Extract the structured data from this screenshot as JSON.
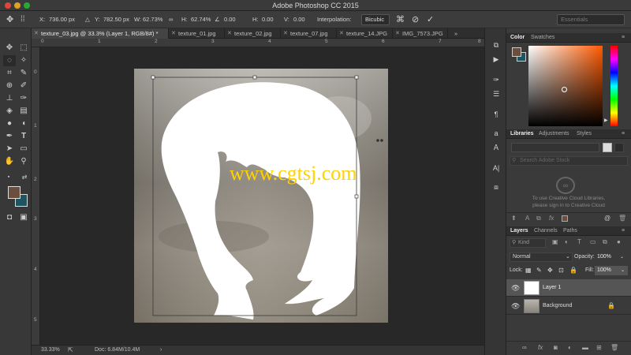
{
  "app": {
    "title": "Adobe Photoshop CC 2015"
  },
  "options": {
    "x_label": "X:",
    "x_value": "736.00 px",
    "y_label": "Y:",
    "y_value": "782.50 px",
    "w_label": "W:",
    "w_value": "62.73%",
    "h_label": "H:",
    "h_value": "62.74%",
    "rot_value": "0.00",
    "hskew_label": "H:",
    "hskew_value": "0.00",
    "vskew_label": "V:",
    "vskew_value": "0.00",
    "interp_label": "Interpolation:",
    "interp_value": "Bicubic",
    "workspace": "Essentials"
  },
  "tabs": [
    {
      "label": "texture_03.jpg @ 33.3% (Layer 1, RGB/8#) *"
    },
    {
      "label": "texture_01.jpg"
    },
    {
      "label": "texture_02.jpg"
    },
    {
      "label": "texture_07.jpg"
    },
    {
      "label": "texture_14.JPG"
    },
    {
      "label": "IMG_7573.JPG"
    }
  ],
  "ruler": {
    "h": [
      "0",
      "1",
      "2",
      "3",
      "4",
      "5",
      "6",
      "7",
      "8"
    ],
    "v": [
      "0",
      "1",
      "2",
      "3",
      "4",
      "5"
    ]
  },
  "status": {
    "zoom": "33.33%",
    "doc": "Doc: 6.84M/10.4M"
  },
  "watermark": "www.cgtsj.com",
  "colors": {
    "foreground": "#6b4f3e",
    "background": "#1d5560"
  },
  "panels": {
    "color_tabs": [
      "Color",
      "Swatches"
    ],
    "libraries_tabs": [
      "Libraries",
      "Adjustments",
      "Styles"
    ],
    "search_placeholder": "Search Adobe Stock",
    "library_msg1": "To use Creative Cloud Libraries,",
    "library_msg2": "please sign in to Creative Cloud",
    "layers_tabs": [
      "Layers",
      "Channels",
      "Paths"
    ],
    "kind_label": "Kind",
    "blend_mode": "Normal",
    "opacity_label": "Opacity:",
    "opacity_value": "100%",
    "lock_label": "Lock:",
    "fill_label": "Fill:",
    "fill_value": "100%",
    "layers": [
      {
        "name": "Layer 1"
      },
      {
        "name": "Background"
      }
    ]
  }
}
